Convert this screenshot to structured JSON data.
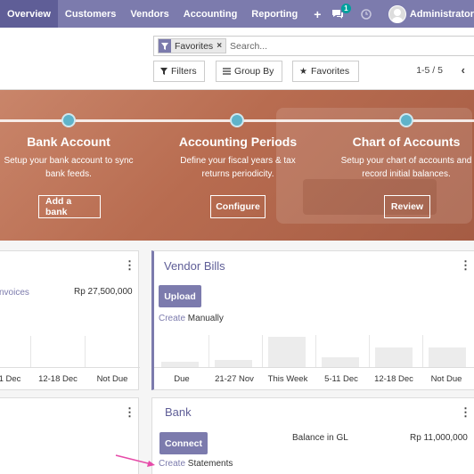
{
  "navbar": {
    "menus": [
      "Overview",
      "Customers",
      "Vendors",
      "Accounting",
      "Reporting"
    ],
    "plus": "+",
    "chat_badge": "1",
    "user_name": "Administrator"
  },
  "control_panel": {
    "facet_label": "Favorites",
    "facet_remove": "×",
    "search_placeholder": "Search...",
    "filters_label": "Filters",
    "groupby_label": "Group By",
    "favorites_label": "Favorites",
    "pager": "1-5 / 5",
    "pager_prev": "‹"
  },
  "banner": {
    "steps": [
      {
        "title": "Bank Account",
        "desc1": "Setup your bank account to sync",
        "desc2": "bank feeds.",
        "button": "Add a bank"
      },
      {
        "title": "Accounting Periods",
        "desc1": "Define your fiscal years & tax",
        "desc2": "returns periodicity.",
        "button": "Configure"
      },
      {
        "title": "Chart of Accounts",
        "desc1": "Setup your chart of accounts and",
        "desc2": "record initial balances.",
        "button": "Review"
      }
    ]
  },
  "customer_invoices": {
    "partial_label": "nvoices",
    "amount": "Rp 27,500,000",
    "x_labels": [
      "1 Dec",
      "12-18 Dec",
      "Not Due"
    ]
  },
  "vendor_bills": {
    "title": "Vendor Bills",
    "upload": "Upload",
    "create_link": "Create",
    "create_rest": "Manually",
    "x_labels": [
      "Due",
      "21-27 Nov",
      "This Week",
      "5-11 Dec",
      "12-18 Dec",
      "Not Due"
    ],
    "chart_data": {
      "type": "bar",
      "categories": [
        "Due",
        "21-27 Nov",
        "This Week",
        "5-11 Dec",
        "12-18 Dec",
        "Not Due"
      ],
      "values": [
        5,
        7,
        28,
        9,
        18,
        18
      ]
    }
  },
  "bank": {
    "title": "Bank",
    "connect": "Connect",
    "balance_label": "Balance in GL",
    "balance_value": "Rp 11,000,000",
    "create_link": "Create",
    "create_rest": "Statements"
  },
  "menu_glyph": "⋮",
  "colors": {
    "navbar": "#7c7bad",
    "accent": "#7c7bad",
    "annotation_arrow": "#e64aa8"
  }
}
